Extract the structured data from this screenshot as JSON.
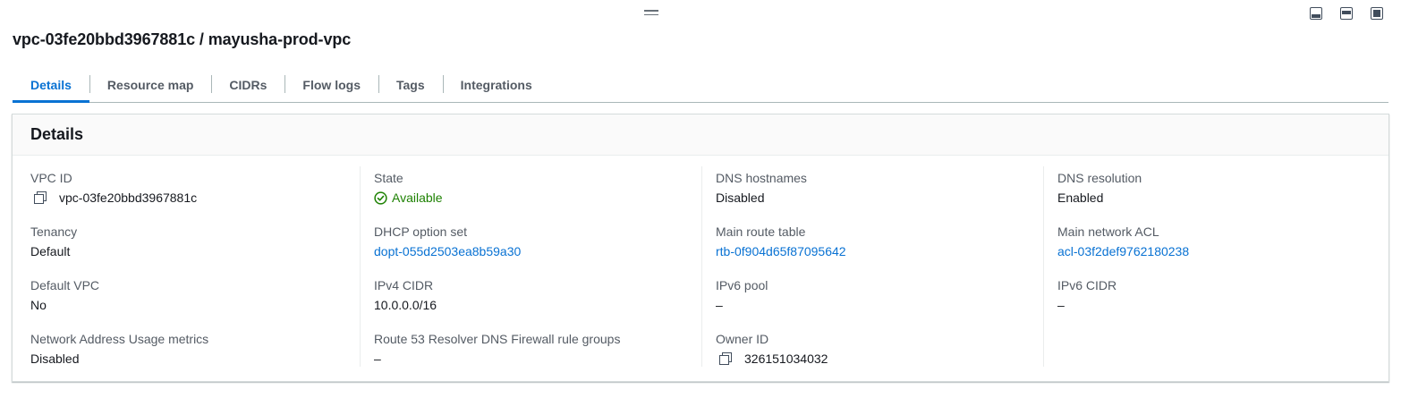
{
  "page_title": "vpc-03fe20bbd3967881c / mayusha-prod-vpc",
  "tabs": [
    {
      "label": "Details"
    },
    {
      "label": "Resource map"
    },
    {
      "label": "CIDRs"
    },
    {
      "label": "Flow logs"
    },
    {
      "label": "Tags"
    },
    {
      "label": "Integrations"
    }
  ],
  "active_tab": "Details",
  "panel": {
    "title": "Details",
    "fields": {
      "vpc_id": {
        "label": "VPC ID",
        "value": "vpc-03fe20bbd3967881c"
      },
      "state": {
        "label": "State",
        "value": "Available"
      },
      "dns_hostnames": {
        "label": "DNS hostnames",
        "value": "Disabled"
      },
      "dns_resolution": {
        "label": "DNS resolution",
        "value": "Enabled"
      },
      "tenancy": {
        "label": "Tenancy",
        "value": "Default"
      },
      "dhcp_option_set": {
        "label": "DHCP option set",
        "value": "dopt-055d2503ea8b59a30"
      },
      "main_route_table": {
        "label": "Main route table",
        "value": "rtb-0f904d65f87095642"
      },
      "main_network_acl": {
        "label": "Main network ACL",
        "value": "acl-03f2def9762180238"
      },
      "default_vpc": {
        "label": "Default VPC",
        "value": "No"
      },
      "ipv4_cidr": {
        "label": "IPv4 CIDR",
        "value": "10.0.0.0/16"
      },
      "ipv6_pool": {
        "label": "IPv6 pool",
        "value": "–"
      },
      "ipv6_cidr": {
        "label": "IPv6 CIDR",
        "value": "–"
      },
      "nau_metrics": {
        "label": "Network Address Usage metrics",
        "value": "Disabled"
      },
      "route53_firewall": {
        "label": "Route 53 Resolver DNS Firewall rule groups",
        "value": "–"
      },
      "owner_id": {
        "label": "Owner ID",
        "value": "326151034032"
      }
    }
  },
  "colors": {
    "link": "#0972d3",
    "success": "#1d8102",
    "text": "#16191f",
    "label": "#545b64"
  },
  "icons": [
    "drag-handle-icon",
    "layout-bottom-icon",
    "layout-side-icon",
    "layout-full-icon",
    "copy-icon",
    "status-check-icon"
  ]
}
